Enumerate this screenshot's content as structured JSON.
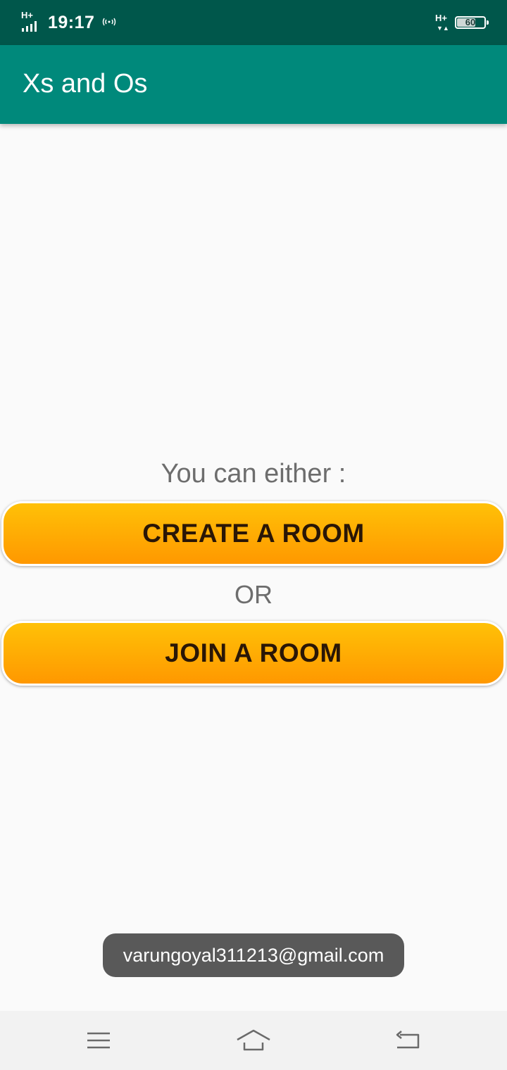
{
  "status_bar": {
    "network_left": "H+",
    "time": "19:17",
    "hotspot_icon": "hotspot-icon",
    "network_right": "H+",
    "battery_level": "60"
  },
  "app_bar": {
    "title": "Xs and Os"
  },
  "main": {
    "prompt": "You can either :",
    "create_button": "CREATE A ROOM",
    "or_label": "OR",
    "join_button": "JOIN A ROOM"
  },
  "toast": {
    "text": "varungoyal311213@gmail.com"
  },
  "nav_bar": {
    "icons": [
      "menu-icon",
      "home-icon",
      "back-icon"
    ]
  },
  "colors": {
    "status_bar": "#00574b",
    "app_bar": "#00897b",
    "button_top": "#ffc107",
    "button_bottom": "#ff9800",
    "toast": "#595959"
  }
}
